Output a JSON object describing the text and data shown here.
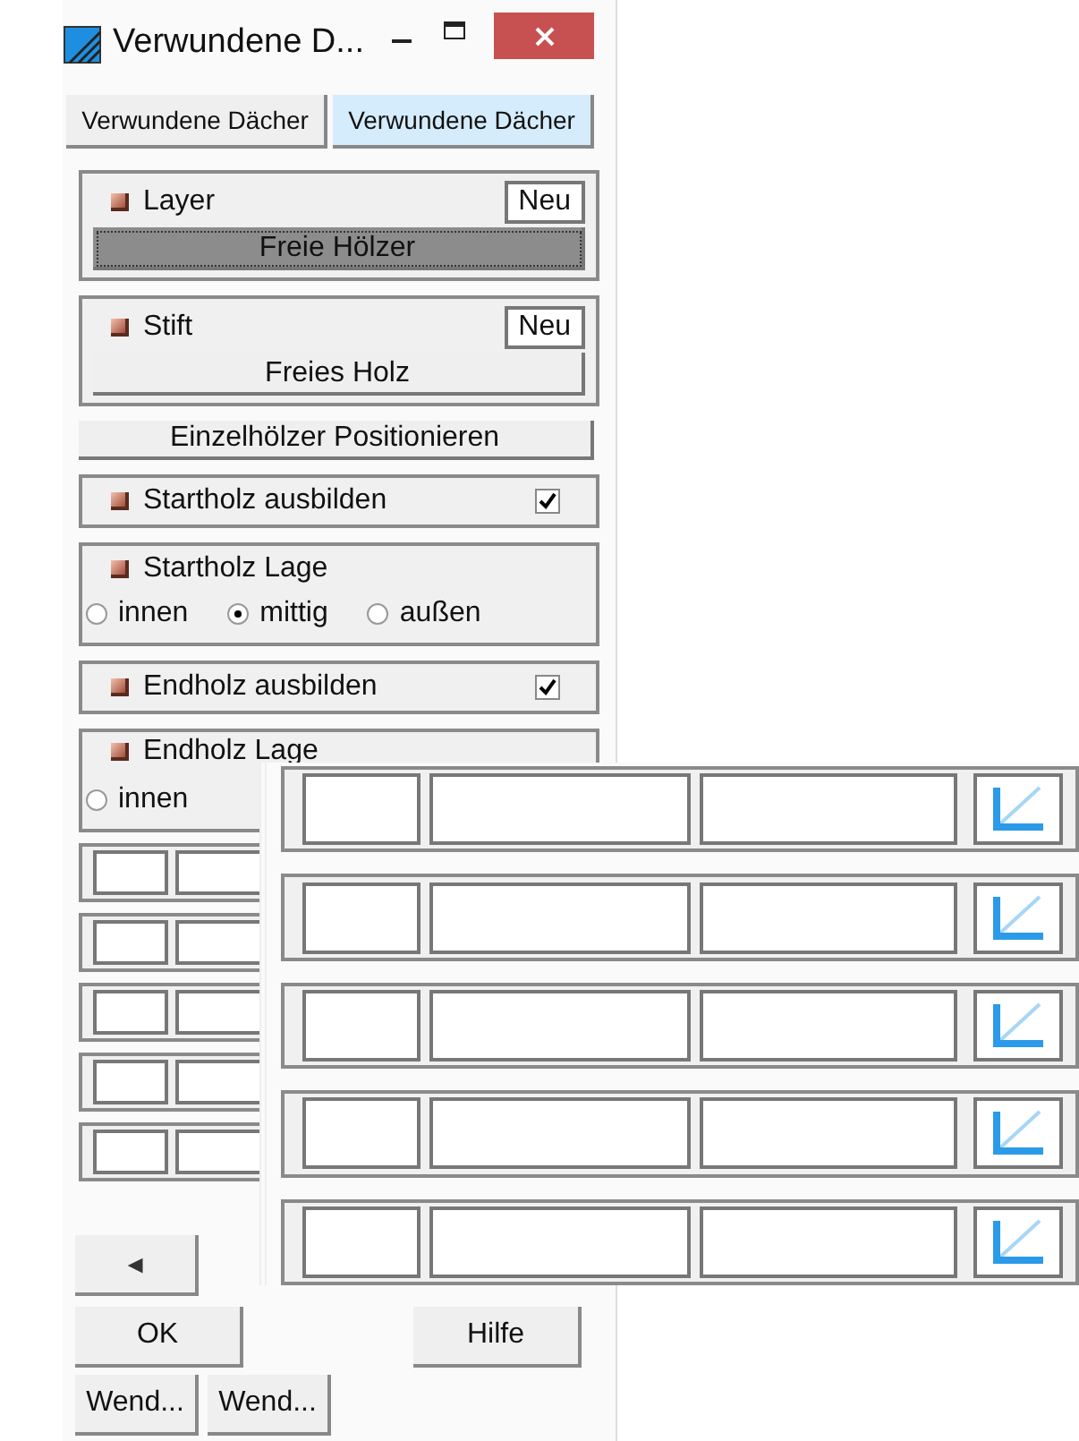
{
  "window": {
    "title": "Verwundene D..."
  },
  "tabs": [
    {
      "label": "Verwundene Dächer",
      "selected": false
    },
    {
      "label": "Verwundene Dächer",
      "selected": true
    }
  ],
  "layer": {
    "label": "Layer",
    "new_button": "Neu",
    "value": "Freie Hölzer",
    "focused": true
  },
  "pen": {
    "label": "Stift",
    "new_button": "Neu",
    "value": "Freies Holz",
    "focused": false
  },
  "position_button": "Einzelhölzer Positionieren",
  "start_build": {
    "label": "Startholz ausbilden",
    "checked": true
  },
  "start_position": {
    "label": "Startholz Lage",
    "options": [
      {
        "label": "innen",
        "selected": false
      },
      {
        "label": "mittig",
        "selected": true
      },
      {
        "label": "außen",
        "selected": false
      }
    ]
  },
  "end_build": {
    "label": "Endholz ausbilden",
    "checked": true
  },
  "end_position": {
    "label": "Endholz Lage",
    "options": [
      {
        "label": "innen",
        "selected": false
      }
    ]
  },
  "back_button": "◄",
  "buttons": [
    {
      "label": "OK"
    },
    {
      "label": "Hilfe"
    }
  ],
  "bottom_buttons": [
    {
      "label": "Wend..."
    },
    {
      "label": "Wend..."
    }
  ]
}
